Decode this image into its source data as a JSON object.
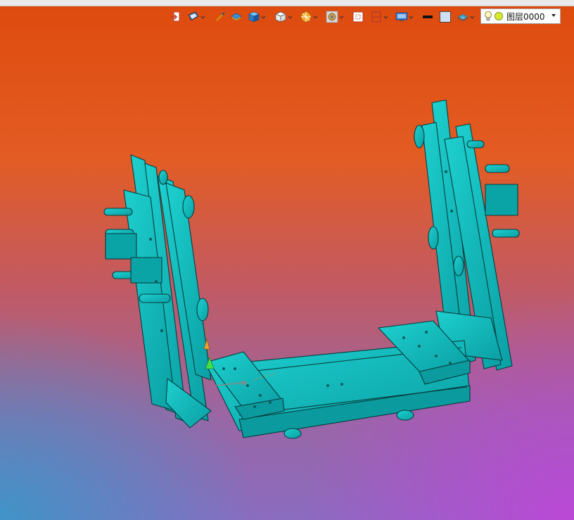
{
  "toolbar": {
    "items": [
      {
        "name": "exit-icon",
        "dropdown": false
      },
      {
        "name": "view-icon",
        "dropdown": true
      },
      {
        "name": "pencil-icon",
        "dropdown": false
      },
      {
        "name": "layer-block-icon",
        "dropdown": false
      },
      {
        "name": "cube-shaded-icon",
        "dropdown": true
      },
      {
        "name": "cube-white-icon",
        "dropdown": true
      },
      {
        "name": "section-icon",
        "dropdown": true
      },
      {
        "name": "render-icon",
        "dropdown": true
      },
      {
        "name": "frame-icon",
        "dropdown": false
      },
      {
        "name": "clip-icon",
        "dropdown": true
      },
      {
        "name": "display-icon",
        "dropdown": true
      },
      {
        "name": "line-weight-icon",
        "dropdown": false
      },
      {
        "name": "color-square-icon",
        "dropdown": false
      },
      {
        "name": "layer-icon",
        "dropdown": true
      }
    ]
  },
  "layer": {
    "name": "图层0000",
    "icons": [
      "bulb-icon",
      "dot-icon"
    ]
  },
  "colors": {
    "model": "#00b3b3",
    "toolbar_bg": "#e9e9e9"
  }
}
